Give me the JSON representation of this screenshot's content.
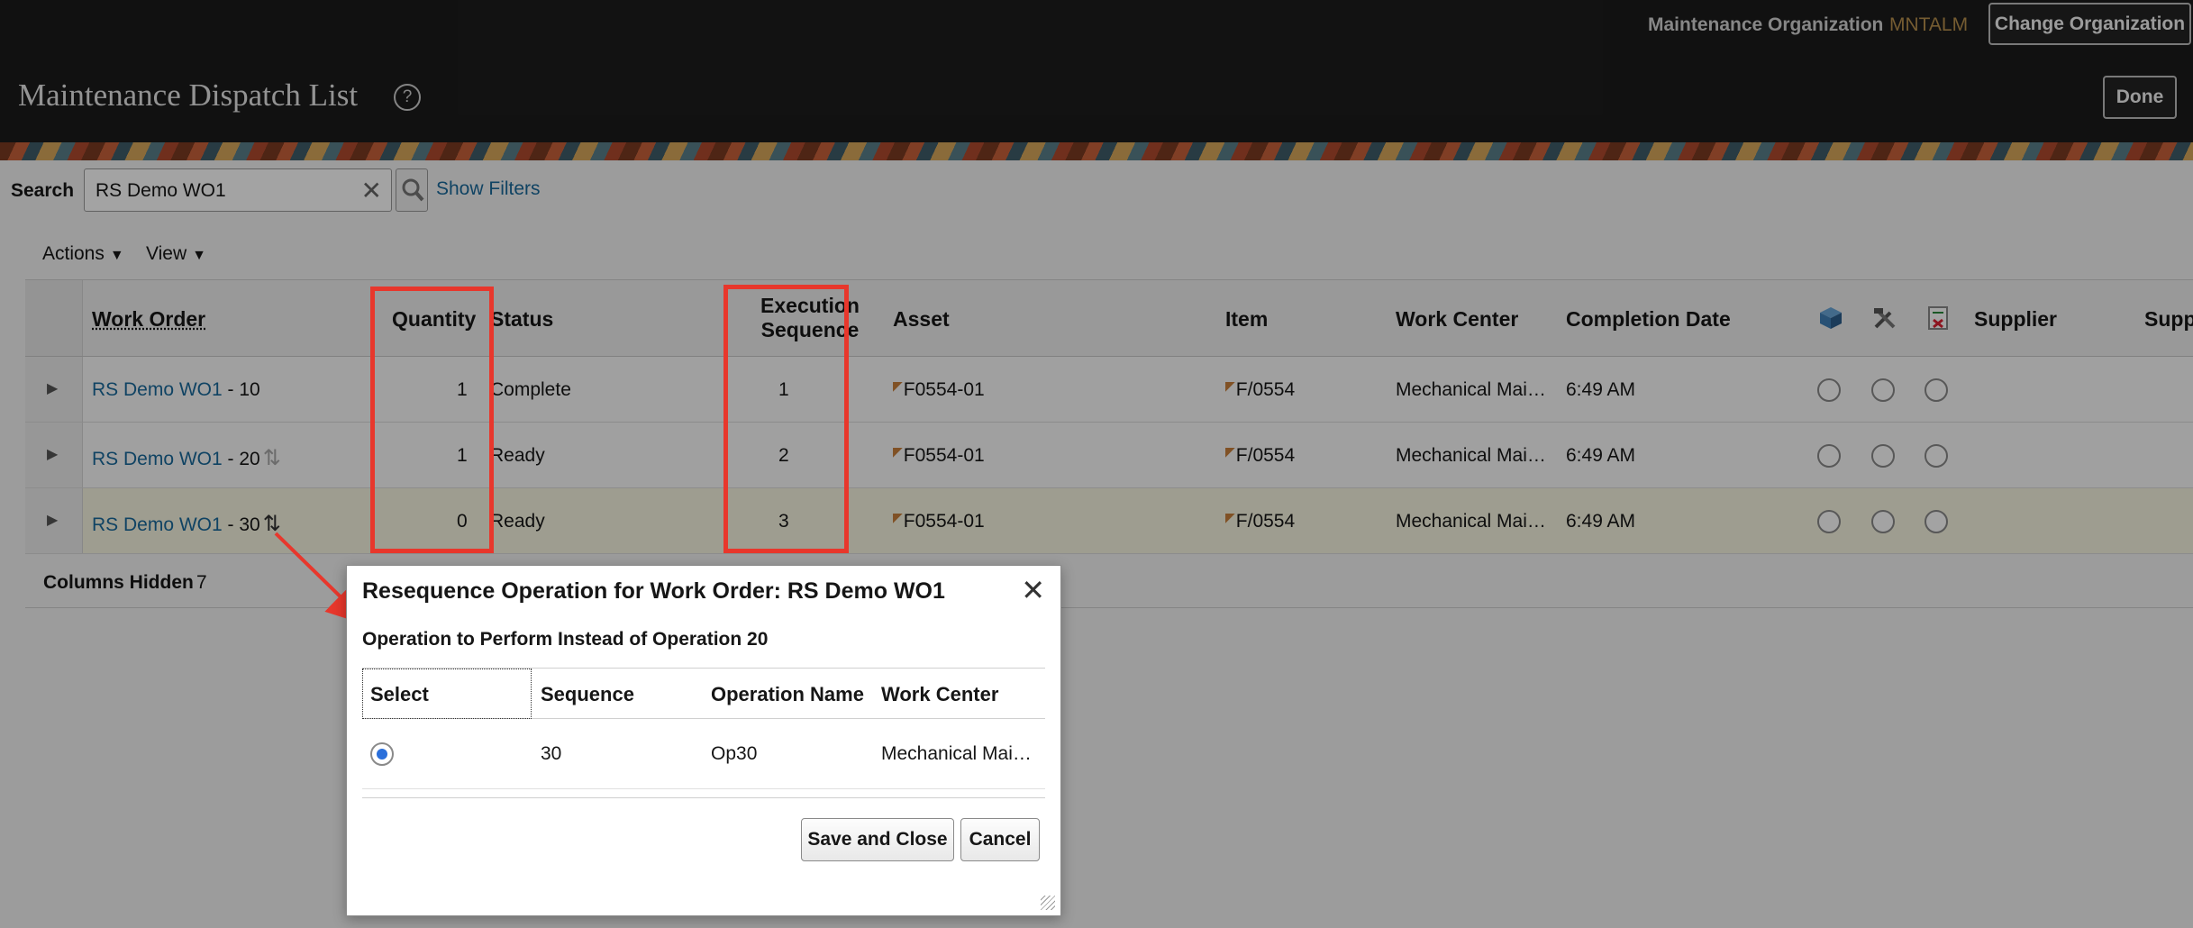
{
  "header": {
    "org_label": "Maintenance Organization",
    "org_code": "MNTALM",
    "change_org_label": "Change Organization",
    "page_title": "Maintenance Dispatch List",
    "help_glyph": "?",
    "done_label": "Done"
  },
  "search": {
    "label": "Search",
    "value": "RS Demo WO1",
    "clear_glyph": "✕",
    "show_filters": "Show Filters"
  },
  "toolbar": {
    "actions_label": "Actions",
    "view_label": "View",
    "caret_glyph": "▼"
  },
  "table": {
    "columns": {
      "work_order": "Work Order",
      "quantity": "Quantity",
      "status": "Status",
      "exec_seq_line1": "Execution",
      "exec_seq_line2": "Sequence",
      "asset": "Asset",
      "item": "Item",
      "work_center": "Work Center",
      "completion_date": "Completion Date",
      "supplier": "Supplier",
      "supplier2_partial": "Supp"
    },
    "header_icons": [
      "cube-icon",
      "tools-icon",
      "checklist-icon"
    ],
    "expand_glyph": "▶",
    "flag_glyph": "◤",
    "rows": [
      {
        "wo_link": "RS Demo WO1",
        "op_suffix": " - 10",
        "reseq": "",
        "quantity": "1",
        "status": "Complete",
        "exec_seq": "1",
        "asset": "F0554-01",
        "item": "F/0554",
        "work_center": "Mechanical Mai…",
        "completion": "6:49 AM"
      },
      {
        "wo_link": "RS Demo WO1",
        "op_suffix": " - 20",
        "reseq": "⇅",
        "quantity": "1",
        "status": "Ready",
        "exec_seq": "2",
        "asset": "F0554-01",
        "item": "F/0554",
        "work_center": "Mechanical Mai…",
        "completion": "6:49 AM"
      },
      {
        "wo_link": "RS Demo WO1",
        "op_suffix": " - 30",
        "reseq": "⇅",
        "quantity": "0",
        "status": "Ready",
        "exec_seq": "3",
        "asset": "F0554-01",
        "item": "F/0554",
        "work_center": "Mechanical Mai…",
        "completion": "6:49 AM"
      }
    ],
    "columns_hidden_label": "Columns Hidden",
    "columns_hidden_count": "7"
  },
  "dialog": {
    "title": "Resequence Operation for Work Order: RS Demo WO1",
    "close_glyph": "✕",
    "subtitle": "Operation to Perform Instead of Operation 20",
    "columns": {
      "select": "Select",
      "sequence": "Sequence",
      "operation_name": "Operation Name",
      "work_center": "Work Center"
    },
    "rows": [
      {
        "sequence": "30",
        "operation_name": "Op30",
        "work_center": "Mechanical Mai…"
      }
    ],
    "save_label": "Save and Close",
    "cancel_label": "Cancel"
  },
  "colors": {
    "header_bg": "#1c1c1c",
    "link": "#1a6a9c",
    "highlight": "#e8372c",
    "org_code": "#b8904e",
    "radio_selected": "#2a6fdb"
  }
}
